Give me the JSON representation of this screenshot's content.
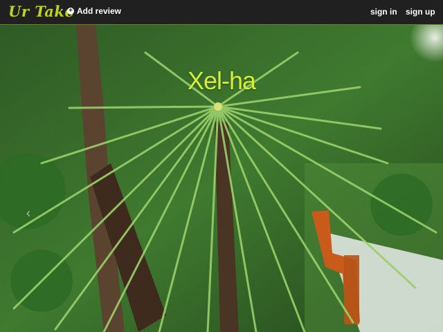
{
  "nav": {
    "logo": "Ur Take",
    "add_review": "Add review",
    "sign_in": "sign in",
    "sign_up": "sign up"
  },
  "hero": {
    "place_name": "Xel-ha",
    "prev_arrow": "‹"
  }
}
